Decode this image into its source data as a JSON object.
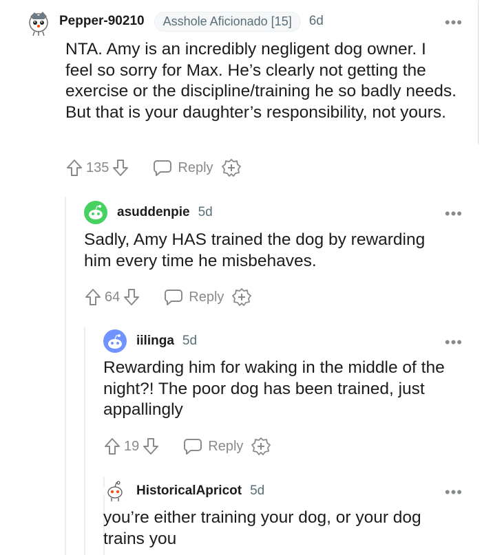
{
  "comments": [
    {
      "username": "Pepper-90210",
      "flair": "Asshole Aficionado [15]",
      "age": "6d",
      "text": "NTA. Amy is an incredibly negligent dog owner. I feel so sorry for Max. He’s clearly not getting the exercise or the discipline/training he so badly needs. But that is your daughter’s responsibility, not yours.",
      "votes": "135",
      "reply_label": "Reply",
      "avatar_icon": "snoo-gray-icon"
    },
    {
      "username": "asuddenpie",
      "age": "5d",
      "text": "Sadly, Amy HAS trained the dog by rewarding him every time he misbehaves.",
      "votes": "64",
      "reply_label": "Reply",
      "avatar_icon": "snoo-green-icon"
    },
    {
      "username": "iilinga",
      "age": "5d",
      "text": "Rewarding him for waking in the middle of the night?! The poor dog has been trained, just appallingly",
      "votes": "19",
      "reply_label": "Reply",
      "avatar_icon": "snoo-blue-icon"
    },
    {
      "username": "HistoricalApricot",
      "age": "5d",
      "text": "you’re either training your dog, or your dog trains you",
      "avatar_icon": "snoo-white-icon"
    }
  ],
  "colors": {
    "meta_gray": "#878a8c",
    "thread_line": "#ededed",
    "avatar_green": "#46d160",
    "avatar_blue": "#7193ff"
  }
}
